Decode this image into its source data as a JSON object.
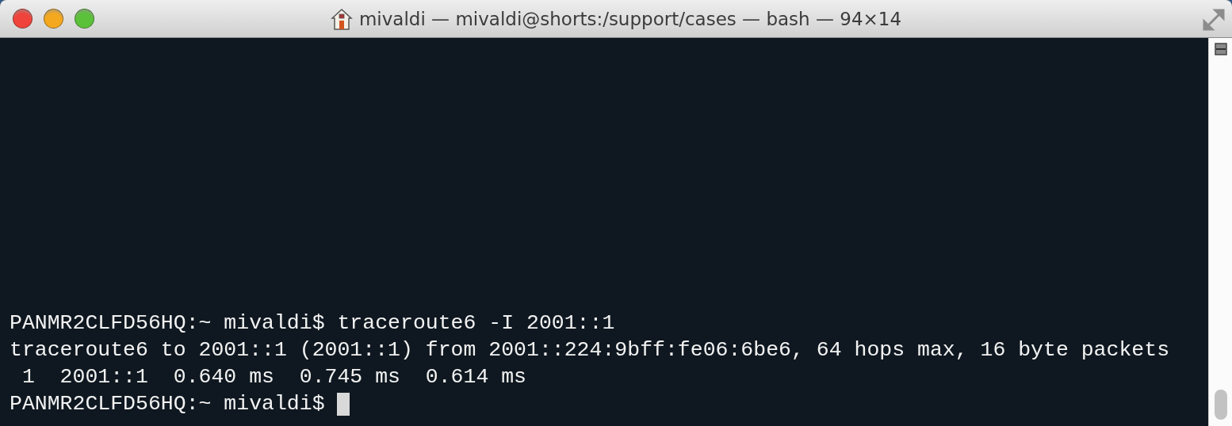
{
  "window": {
    "title": "mivaldi — mivaldi@shorts:/support/cases — bash — 94×14"
  },
  "terminal": {
    "lines": [
      {
        "text": "PANMR2CLFD56HQ:~ mivaldi$ traceroute6 -I 2001::1",
        "cursor": false
      },
      {
        "text": "traceroute6 to 2001::1 (2001::1) from 2001::224:9bff:fe06:6be6, 64 hops max, 16 byte packets",
        "cursor": false
      },
      {
        "text": " 1  2001::1  0.640 ms  0.745 ms  0.614 ms",
        "cursor": false
      },
      {
        "text": "PANMR2CLFD56HQ:~ mivaldi$ ",
        "cursor": true
      }
    ]
  }
}
